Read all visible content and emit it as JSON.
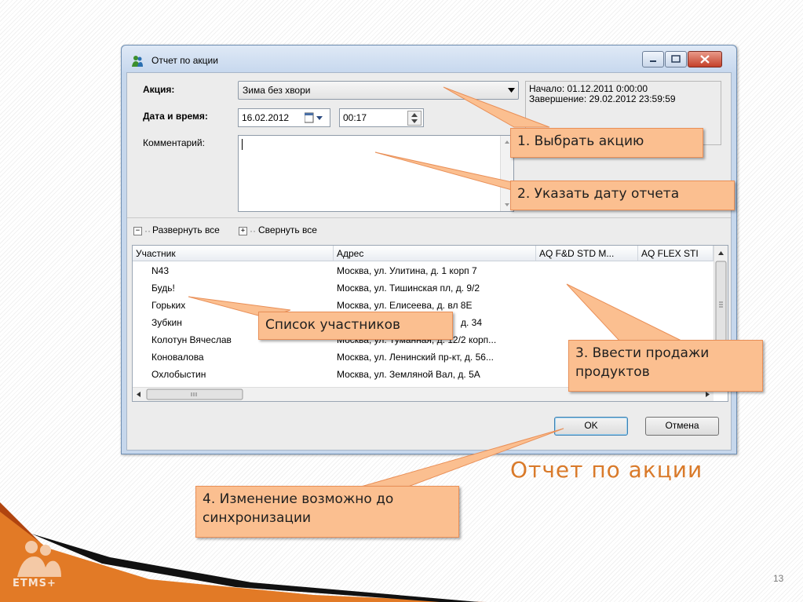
{
  "window": {
    "title": "Отчет по акции",
    "controls": {
      "minimize": "minimize-icon",
      "maximize": "maximize-icon",
      "close": "close-icon"
    }
  },
  "form": {
    "promo_label": "Акция:",
    "promo_value": "Зима без хвори",
    "datetime_label": "Дата и время:",
    "date_value": "16.02.2012",
    "time_value": "00:17",
    "comment_label": "Комментарий:",
    "comment_value": "",
    "info_start": "Начало: 01.12.2011 0:00:00",
    "info_end": "Завершение: 29.02.2012 23:59:59"
  },
  "tree_toolbar": {
    "expand_all": "Развернуть все",
    "collapse_all": "Свернуть все"
  },
  "grid": {
    "columns": [
      "Участник",
      "Адрес",
      "AQ F&D STD M...",
      "AQ FLEX STI"
    ],
    "rows": [
      {
        "participant": "N43",
        "address": "Москва, ул. Улитина, д. 1 корп 7"
      },
      {
        "participant": "Будь!",
        "address": "Москва, ул. Тишинская пл, д. 9/2"
      },
      {
        "participant": "Горьких",
        "address": "Москва, ул. Елисеева, д. вл 8Е"
      },
      {
        "participant": "Зубкин",
        "address": "д. 34"
      },
      {
        "participant": "Колотун Вячеслав",
        "address": "Москва, ул. Туманная, д. 12/2 корп..."
      },
      {
        "participant": "Коновалова",
        "address": "Москва, ул. Ленинский пр-кт, д. 56..."
      },
      {
        "participant": "Охлобыстин",
        "address": "Москва, ул. Земляной Вал, д. 5А"
      }
    ]
  },
  "buttons": {
    "ok": "OK",
    "cancel": "Отмена"
  },
  "callouts": {
    "c1": "1. Выбрать акцию",
    "c2": "2. Указать дату отчета",
    "c3": "3. Ввести продажи продуктов",
    "c4": "4. Изменение возможно до синхронизации",
    "list": "Список участников"
  },
  "slide": {
    "title": "Отчет по акции",
    "page_number": "13",
    "logo_text": "ETMS+"
  },
  "colors": {
    "accent": "#d97a2a",
    "callout_fill": "#fbbf90",
    "callout_border": "#e98f57"
  }
}
